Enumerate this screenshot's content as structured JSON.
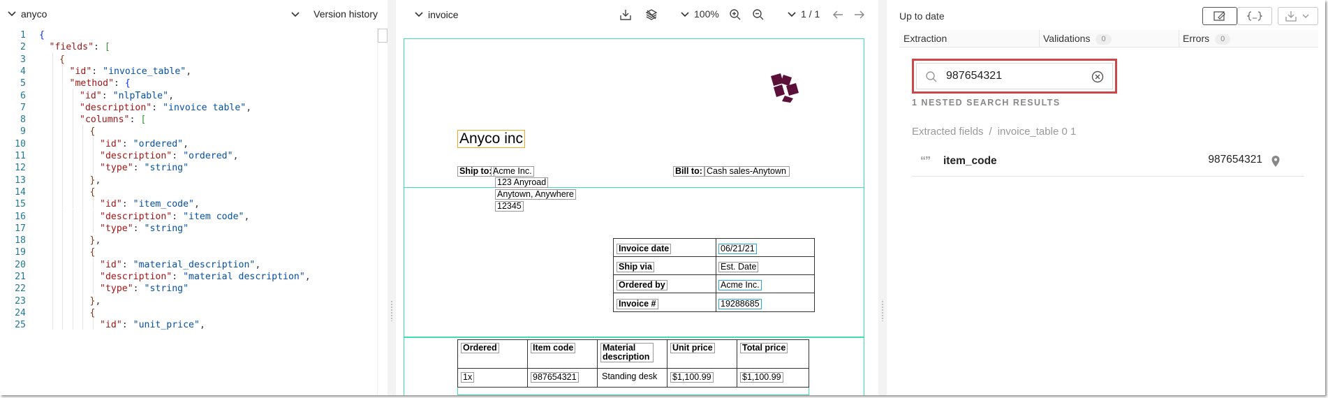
{
  "editor": {
    "title": "anyco",
    "version_history_label": "Version history",
    "lines": [
      {
        "n": "1",
        "indent": 0,
        "tokens": [
          {
            "t": "{",
            "c": "b1"
          }
        ]
      },
      {
        "n": "2",
        "indent": 1,
        "tokens": [
          {
            "t": "\"fields\"",
            "c": "k"
          },
          {
            "t": ": ",
            "c": "p"
          },
          {
            "t": "[",
            "c": "b2"
          }
        ]
      },
      {
        "n": "3",
        "indent": 2,
        "tokens": [
          {
            "t": "{",
            "c": "b3"
          }
        ]
      },
      {
        "n": "4",
        "indent": 3,
        "tokens": [
          {
            "t": "\"id\"",
            "c": "k"
          },
          {
            "t": ": ",
            "c": "p"
          },
          {
            "t": "\"invoice_table\"",
            "c": "s"
          },
          {
            "t": ",",
            "c": "p"
          }
        ]
      },
      {
        "n": "5",
        "indent": 3,
        "tokens": [
          {
            "t": "\"method\"",
            "c": "k"
          },
          {
            "t": ": ",
            "c": "p"
          },
          {
            "t": "{",
            "c": "b1"
          }
        ]
      },
      {
        "n": "6",
        "indent": 4,
        "tokens": [
          {
            "t": "\"id\"",
            "c": "k"
          },
          {
            "t": ": ",
            "c": "p"
          },
          {
            "t": "\"nlpTable\"",
            "c": "s"
          },
          {
            "t": ",",
            "c": "p"
          }
        ]
      },
      {
        "n": "7",
        "indent": 4,
        "tokens": [
          {
            "t": "\"description\"",
            "c": "k"
          },
          {
            "t": ": ",
            "c": "p"
          },
          {
            "t": "\"invoice table\"",
            "c": "s"
          },
          {
            "t": ",",
            "c": "p"
          }
        ]
      },
      {
        "n": "8",
        "indent": 4,
        "tokens": [
          {
            "t": "\"columns\"",
            "c": "k"
          },
          {
            "t": ": ",
            "c": "p"
          },
          {
            "t": "[",
            "c": "b2"
          }
        ]
      },
      {
        "n": "9",
        "indent": 5,
        "tokens": [
          {
            "t": "{",
            "c": "b3"
          }
        ]
      },
      {
        "n": "10",
        "indent": 6,
        "tokens": [
          {
            "t": "\"id\"",
            "c": "k"
          },
          {
            "t": ": ",
            "c": "p"
          },
          {
            "t": "\"ordered\"",
            "c": "s"
          },
          {
            "t": ",",
            "c": "p"
          }
        ]
      },
      {
        "n": "11",
        "indent": 6,
        "tokens": [
          {
            "t": "\"description\"",
            "c": "k"
          },
          {
            "t": ": ",
            "c": "p"
          },
          {
            "t": "\"ordered\"",
            "c": "s"
          },
          {
            "t": ",",
            "c": "p"
          }
        ]
      },
      {
        "n": "12",
        "indent": 6,
        "tokens": [
          {
            "t": "\"type\"",
            "c": "k"
          },
          {
            "t": ": ",
            "c": "p"
          },
          {
            "t": "\"string\"",
            "c": "s"
          }
        ]
      },
      {
        "n": "13",
        "indent": 5,
        "tokens": [
          {
            "t": "}",
            "c": "b3"
          },
          {
            "t": ",",
            "c": "p"
          }
        ]
      },
      {
        "n": "14",
        "indent": 5,
        "tokens": [
          {
            "t": "{",
            "c": "b3"
          }
        ]
      },
      {
        "n": "15",
        "indent": 6,
        "tokens": [
          {
            "t": "\"id\"",
            "c": "k"
          },
          {
            "t": ": ",
            "c": "p"
          },
          {
            "t": "\"item_code\"",
            "c": "s"
          },
          {
            "t": ",",
            "c": "p"
          }
        ]
      },
      {
        "n": "16",
        "indent": 6,
        "tokens": [
          {
            "t": "\"description\"",
            "c": "k"
          },
          {
            "t": ": ",
            "c": "p"
          },
          {
            "t": "\"item code\"",
            "c": "s"
          },
          {
            "t": ",",
            "c": "p"
          }
        ]
      },
      {
        "n": "17",
        "indent": 6,
        "tokens": [
          {
            "t": "\"type\"",
            "c": "k"
          },
          {
            "t": ": ",
            "c": "p"
          },
          {
            "t": "\"string\"",
            "c": "s"
          }
        ]
      },
      {
        "n": "18",
        "indent": 5,
        "tokens": [
          {
            "t": "}",
            "c": "b3"
          },
          {
            "t": ",",
            "c": "p"
          }
        ]
      },
      {
        "n": "19",
        "indent": 5,
        "tokens": [
          {
            "t": "{",
            "c": "b3"
          }
        ]
      },
      {
        "n": "20",
        "indent": 6,
        "tokens": [
          {
            "t": "\"id\"",
            "c": "k"
          },
          {
            "t": ": ",
            "c": "p"
          },
          {
            "t": "\"material_description\"",
            "c": "s"
          },
          {
            "t": ",",
            "c": "p"
          }
        ]
      },
      {
        "n": "21",
        "indent": 6,
        "tokens": [
          {
            "t": "\"description\"",
            "c": "k"
          },
          {
            "t": ": ",
            "c": "p"
          },
          {
            "t": "\"material description\"",
            "c": "s"
          },
          {
            "t": ",",
            "c": "p"
          }
        ]
      },
      {
        "n": "22",
        "indent": 6,
        "tokens": [
          {
            "t": "\"type\"",
            "c": "k"
          },
          {
            "t": ": ",
            "c": "p"
          },
          {
            "t": "\"string\"",
            "c": "s"
          }
        ]
      },
      {
        "n": "23",
        "indent": 5,
        "tokens": [
          {
            "t": "}",
            "c": "b3"
          },
          {
            "t": ",",
            "c": "p"
          }
        ]
      },
      {
        "n": "24",
        "indent": 5,
        "tokens": [
          {
            "t": "{",
            "c": "b3"
          }
        ]
      },
      {
        "n": "25",
        "indent": 6,
        "tokens": [
          {
            "t": "\"id\"",
            "c": "k"
          },
          {
            "t": ": ",
            "c": "p"
          },
          {
            "t": "\"unit_price\"",
            "c": "s"
          },
          {
            "t": ",",
            "c": "p"
          }
        ]
      }
    ]
  },
  "viewer": {
    "doc_name": "invoice",
    "zoom": "100%",
    "page_indicator": "1 / 1",
    "document": {
      "company": "Anyco inc",
      "ship_to_label": "Ship to:",
      "ship_to_name": "Acme Inc.",
      "ship_to_addr1": "123 Anyroad",
      "ship_to_addr2": "Anytown, Anywhere",
      "ship_to_zip": "12345",
      "bill_to_label": "Bill to:",
      "bill_to_value": "Cash sales-Anytown",
      "info": [
        {
          "label": "Invoice date",
          "value": "06/21/21"
        },
        {
          "label": "Ship via",
          "value": "Est. Date"
        },
        {
          "label": "Ordered by",
          "value": "Acme Inc."
        },
        {
          "label": "Invoice #",
          "value": "19288685"
        }
      ],
      "line_headers": [
        "Ordered",
        "Item code",
        "Material description",
        "Unit price",
        "Total price"
      ],
      "line_row": [
        "1x",
        "987654321",
        "Standing desk",
        "$1,100.99",
        "$1,100.99"
      ]
    }
  },
  "results": {
    "status": "Up to date",
    "tabs": [
      {
        "label": "Extraction",
        "count": null
      },
      {
        "label": "Validations",
        "count": "0"
      },
      {
        "label": "Errors",
        "count": "0"
      }
    ],
    "search_value": "987654321",
    "results_count": "1 NESTED SEARCH RESULTS",
    "breadcrumb_root": "Extracted fields",
    "breadcrumb_sep": "/",
    "breadcrumb_leaf": "invoice_table 0 1",
    "item_name": "item_code",
    "item_value": "987654321",
    "item_type_glyph": "“”"
  },
  "colors": {
    "zone_green": "#3fe0b0",
    "highlight_orange": "#f5a623",
    "highlight_blue": "#29a8e0",
    "search_outline_red": "#c9494a",
    "logo_color": "#5a1038"
  },
  "icons": [
    "chevron-down-icon",
    "download-icon",
    "layers-icon",
    "zoom-in-icon",
    "zoom-out-icon",
    "arrow-left-icon",
    "arrow-right-icon",
    "search-icon",
    "clear-icon",
    "location-pin-icon",
    "edit-view-icon",
    "json-icon",
    "export-icon",
    "logo-icon",
    "quote-icon"
  ]
}
